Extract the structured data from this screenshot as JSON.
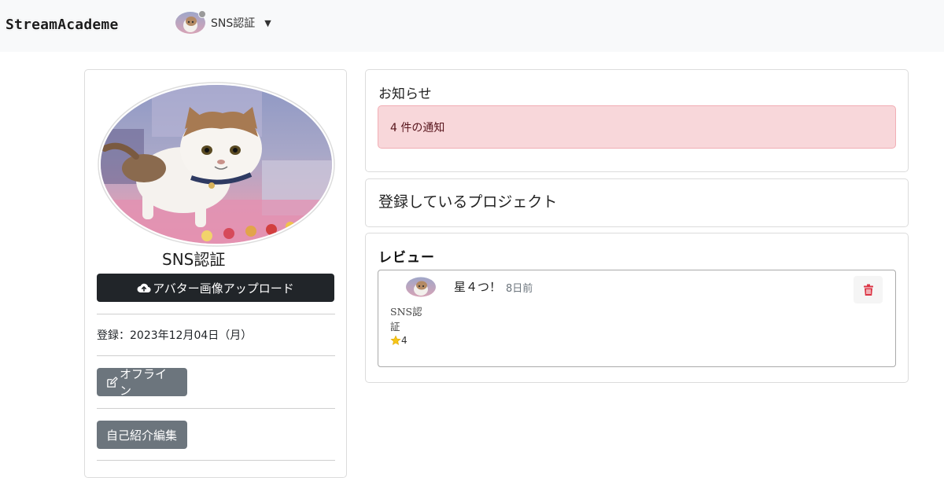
{
  "navbar": {
    "brand": "StreamAcademe",
    "user_name": "SNS認証",
    "avatar_icon": "cat-avatar",
    "caret_icon": "caret-down"
  },
  "profile": {
    "name": "SNS認証",
    "upload_button": "アバター画像アップロード",
    "registration": "登録：2023年12月04日（月）",
    "offline_button": "オフライン",
    "bio_button": "自己紹介編集"
  },
  "notice": {
    "title": "お知らせ",
    "alert_text": "4 件の通知"
  },
  "projects": {
    "title": "登録しているプロジェクト"
  },
  "reviews": {
    "title": "レビュー",
    "items": [
      {
        "stars_text": "星４つ！",
        "time": "8日前",
        "user": "SNS認証",
        "rating": "4"
      }
    ]
  },
  "colors": {
    "navbar_bg": "#f8f9fa",
    "dark_button": "#212529",
    "secondary_button": "#6c757d",
    "alert_bg": "#f8d7da",
    "delete_icon": "#dc3545",
    "star": "#f5c518"
  }
}
